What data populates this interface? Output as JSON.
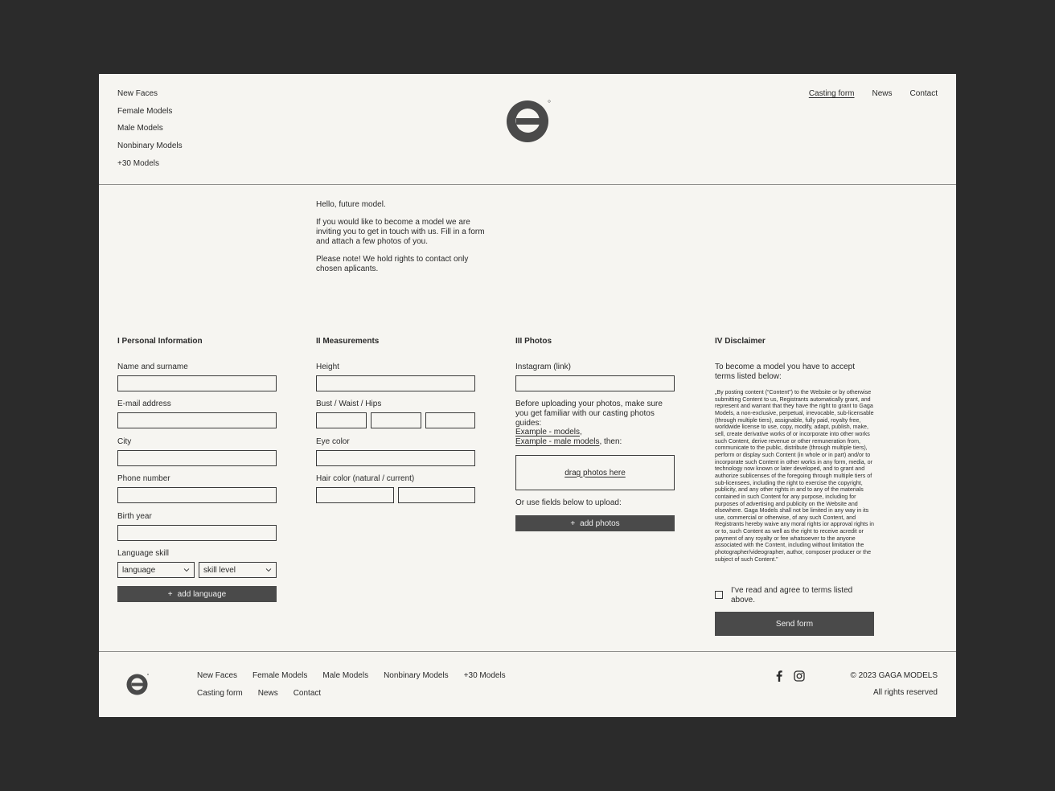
{
  "header": {
    "left_nav": [
      "New Faces",
      "Female Models",
      "Male Models",
      "Nonbinary Models",
      "+30 Models"
    ],
    "right_nav": [
      "Casting form",
      "News",
      "Contact"
    ]
  },
  "intro": {
    "greeting": "Hello, future model.",
    "p1": "If you would like to become a model we are inviting you to get in touch with us. Fill in a form and attach a few photos of you.",
    "p2": "Please note! We hold rights to contact only chosen aplicants."
  },
  "personal": {
    "heading": "I Personal Information",
    "name_label": "Name and surname",
    "email_label": "E-mail address",
    "city_label": "City",
    "phone_label": "Phone number",
    "birth_label": "Birth year",
    "language_label": "Language skill",
    "language_select": "language",
    "skill_select": "skill level",
    "add_language": "add language"
  },
  "measurements": {
    "heading": "II Measurements",
    "height_label": "Height",
    "bwh_label": "Bust / Waist / Hips",
    "eye_label": "Eye color",
    "hair_label": "Hair color (natural / current)"
  },
  "photos": {
    "heading": "III Photos",
    "instagram_label": "Instagram (link)",
    "before_text": "Before uploading your photos, make sure you get familiar with our casting photos guides:",
    "link1": "Example - models",
    "link1_suffix": ",",
    "link2": "Example - male models",
    "link2_suffix": ", then:",
    "drag": "drag photos here",
    "or_text": "Or use fields below to upload:",
    "add_photos": "add photos"
  },
  "disclaimer": {
    "heading": "IV Disclaimer",
    "intro": "To become a model you have to accept terms listed below:",
    "legal": "„By posting content (“Content”) to the Website or by otherwise submitting Content to us, Registrants automatically grant, and represent and warrant that they have the right to grant to Gaga Models, a non-exclusive, perpetual, irrevocable, sub-licensable (through multiple tiers), assignable, fully paid, royalty free, worldwide license to use, copy, modify, adapt, publish, make, sell, create derivative works of or incorporate into other works such Content, derive revenue or other remuneration from, communicate to the public, distribute (through multiple tiers), perform or display such Content (in whole or in part) and/or to incorporate such Content in other works in any form, media, or technology now known or later developed, and to grant and authorize sublicenses of the foregoing through multiple tiers of sub-licensees, including the right to exercise the copyright, publicity, and any other rights in and to any of the materials contained in such Content for any purpose, including for purposes of advertising and publicity on the Website and elsewhere. Gaga Models shall not be limited in any way in its use, commercial or otherwise, of any such Content, and Registrants hereby waive any moral rights ior approval rights in or to, such Content as well as the right to receive acredit or payment of any royalty or fee whatsoever to the anyone associated with the Content, including without limitation the photographer/videographer, author, composer producer or the subject of such Content.”",
    "agree": "I’ve read and agree to terms listed above.",
    "send": "Send form"
  },
  "footer": {
    "row1": [
      "New Faces",
      "Female Models",
      "Male Models",
      "Nonbinary Models",
      "+30 Models"
    ],
    "row2": [
      "Casting form",
      "News",
      "Contact"
    ],
    "copyright": "© 2023 GAGA MODELS",
    "rights": "All rights reserved"
  },
  "icons": {
    "logo": "gaga-logo-icon",
    "facebook": "facebook-icon",
    "instagram": "instagram-icon",
    "plus": "plus-icon",
    "chevron": "chevron-down-icon"
  }
}
